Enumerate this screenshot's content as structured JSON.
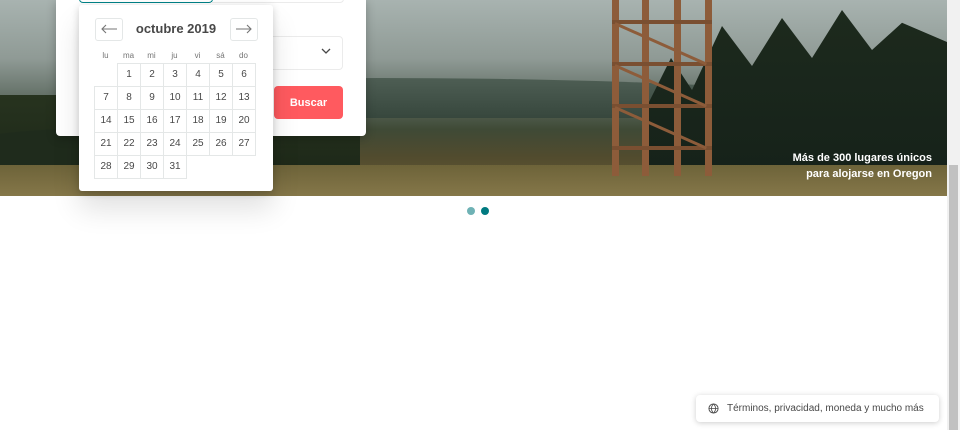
{
  "hero": {
    "caption_line1": "Más de 300 lugares únicos",
    "caption_line2": "para alojarse en Oregon"
  },
  "search": {
    "button_label": "Buscar",
    "guests_icon": "chevron-down-icon"
  },
  "calendar": {
    "month_label": "octubre 2019",
    "prev_icon": "arrow-left-icon",
    "next_icon": "arrow-right-icon",
    "weekdays": [
      "lu",
      "ma",
      "mi",
      "ju",
      "vi",
      "sá",
      "do"
    ],
    "weeks": [
      [
        "",
        "1",
        "2",
        "3",
        "4",
        "5",
        "6"
      ],
      [
        "7",
        "8",
        "9",
        "10",
        "11",
        "12",
        "13"
      ],
      [
        "14",
        "15",
        "16",
        "17",
        "18",
        "19",
        "20"
      ],
      [
        "21",
        "22",
        "23",
        "24",
        "25",
        "26",
        "27"
      ],
      [
        "28",
        "29",
        "30",
        "31",
        "",
        "",
        ""
      ]
    ]
  },
  "carousel": {
    "dots": 2,
    "active_index": 1,
    "colors": {
      "inactive": "#6fb2b5",
      "active": "#007a80"
    }
  },
  "footer": {
    "label": "Términos, privacidad, moneda y mucho más",
    "icon": "globe-icon"
  },
  "colors": {
    "accent": "#ff5a5f",
    "teal": "#008489"
  }
}
